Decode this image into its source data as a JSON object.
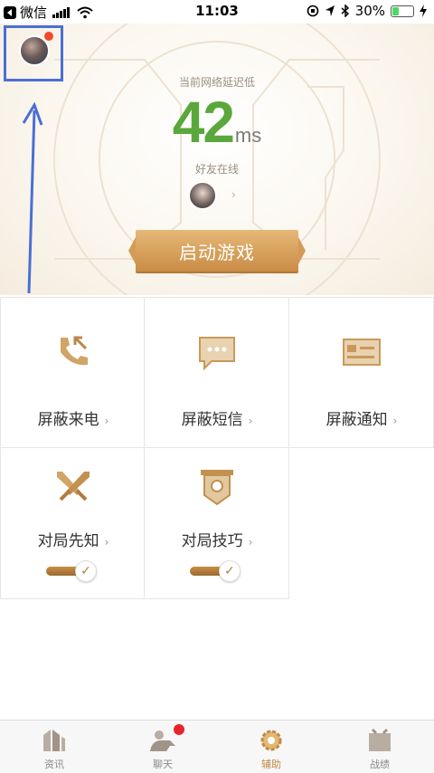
{
  "status_bar": {
    "carrier": "微信",
    "time": "11:03",
    "battery": "30%"
  },
  "hero": {
    "network_label": "当前网络延迟低",
    "latency_value": "42",
    "latency_unit": "ms",
    "friends_online_label": "好友在线",
    "start_button": "启动游戏"
  },
  "grid": [
    {
      "label": "屏蔽来电",
      "icon": "block-call-icon"
    },
    {
      "label": "屏蔽短信",
      "icon": "block-sms-icon"
    },
    {
      "label": "屏蔽通知",
      "icon": "block-notification-icon"
    },
    {
      "label": "对局先知",
      "icon": "crossed-swords-icon",
      "toggle": true
    },
    {
      "label": "对局技巧",
      "icon": "banner-icon",
      "toggle": true
    }
  ],
  "tabs": [
    {
      "label": "资讯",
      "icon": "news-icon"
    },
    {
      "label": "聊天",
      "icon": "chat-icon",
      "badge": true
    },
    {
      "label": "辅助",
      "icon": "assist-icon",
      "active": true
    },
    {
      "label": "战绩",
      "icon": "record-icon"
    }
  ],
  "colors": {
    "accent_gold": "#c98c45",
    "latency_green": "#5aa83b",
    "badge_red": "#e8242a",
    "highlight_blue": "#4a6fd4"
  }
}
